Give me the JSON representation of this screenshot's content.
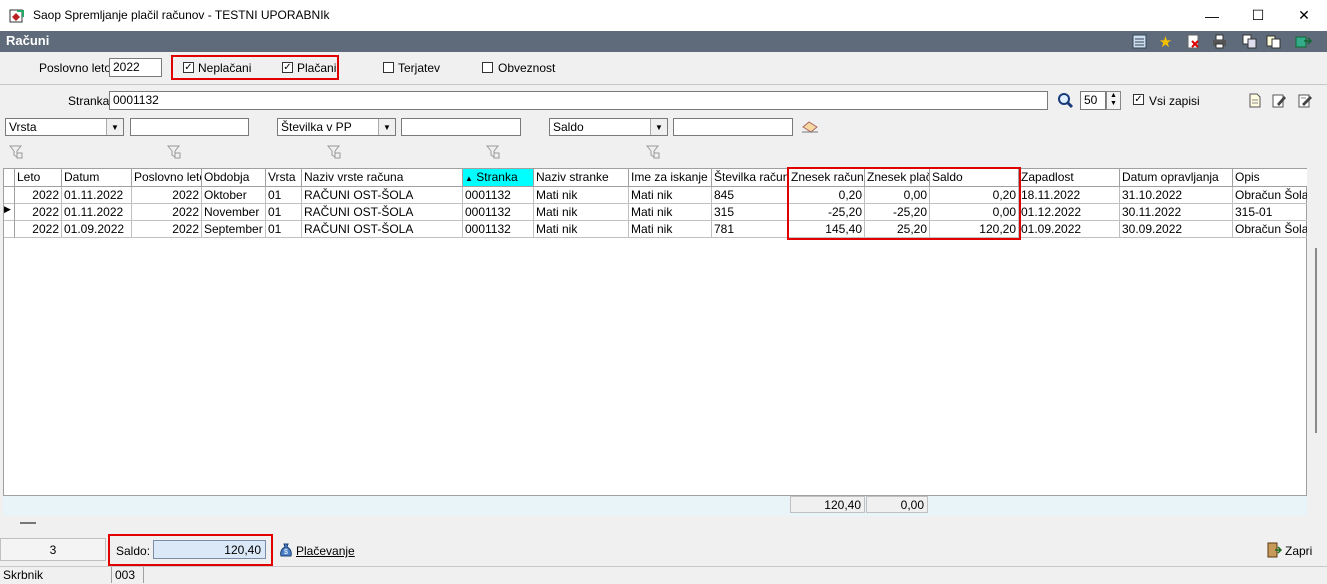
{
  "window": {
    "title": "Saop Spremljanje plačil računov - TESTNI UPORABNIk",
    "minimize": "—",
    "maximize": "☐",
    "close": "✕"
  },
  "header": {
    "title": "Računi",
    "bg_color": "#5f6b7a",
    "icons": [
      "list-icon",
      "star-icon",
      "delete-icon",
      "print-icon",
      "copy-icon",
      "paste-icon",
      "export-icon"
    ]
  },
  "filters": {
    "poslovno_leto_label": "Poslovno leto",
    "poslovno_leto_value": "2022",
    "neplacani_label": "Neplačani",
    "neplacani_checked": true,
    "placani_label": "Plačani",
    "placani_checked": true,
    "terjatev_label": "Terjatev",
    "terjatev_checked": false,
    "obveznost_label": "Obveznost",
    "obveznost_checked": false,
    "stranka_label": "Stranka",
    "stranka_value": "0001132",
    "limit_value": "50",
    "vsi_zapisi_label": "Vsi zapisi",
    "vsi_zapisi_checked": true,
    "combo1": "Vrsta",
    "combo1_text": "",
    "combo2": "Številka v PP",
    "combo2_text": "",
    "combo3": "Saldo",
    "combo3_text": ""
  },
  "grid": {
    "columns": [
      "Leto",
      "Datum",
      "Poslovno leto",
      "Obdobja",
      "Vrsta",
      "Naziv vrste računa",
      "Stranka",
      "Naziv stranke",
      "Ime za iskanje",
      "Številka računa",
      "Znesek računa",
      "Znesek plačil",
      "Saldo",
      "Zapadlost",
      "Datum opravljanja",
      "Opis"
    ],
    "sorted_column": "Stranka",
    "sorted_color": "#00ffff",
    "rows": [
      [
        "2022",
        "01.11.2022",
        "2022",
        "Oktober",
        "01",
        "RAČUNI OST-ŠOLA",
        "0001132",
        "Mati nik",
        "Mati nik",
        "845",
        "0,20",
        "0,00",
        "0,20",
        "18.11.2022",
        "31.10.2022",
        "Obračun Šola_c"
      ],
      [
        "2022",
        "01.11.2022",
        "2022",
        "November",
        "01",
        "RAČUNI OST-ŠOLA",
        "0001132",
        "Mati nik",
        "Mati nik",
        "315",
        "-25,20",
        "-25,20",
        "0,00",
        "01.12.2022",
        "30.11.2022",
        "315-01"
      ],
      [
        "2022",
        "01.09.2022",
        "2022",
        "September",
        "01",
        "RAČUNI OST-ŠOLA",
        "0001132",
        "Mati nik",
        "Mati nik",
        "781",
        "145,40",
        "25,20",
        "120,20",
        "01.09.2022",
        "30.09.2022",
        "Obračun Šola_s"
      ]
    ],
    "current_row": 1,
    "totals": {
      "znesek_racuna": "120,40",
      "znesek_placil": "0,00"
    }
  },
  "bottom": {
    "count": "3",
    "saldo_label": "Saldo:",
    "saldo_value": "120,40",
    "placevanje_label": "Plačevanje",
    "zapri_label": "Zapri"
  },
  "statusbar": {
    "label": "Skrbnik",
    "value": "003"
  },
  "highlight_color": "#e00000"
}
